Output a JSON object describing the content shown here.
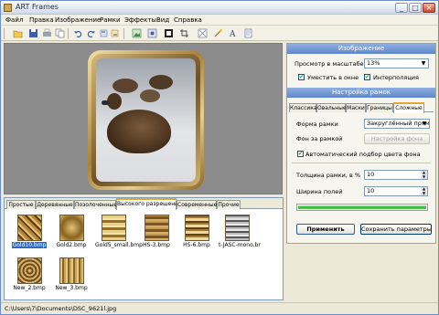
{
  "window": {
    "title": "ART Frames"
  },
  "menu": [
    "Файл",
    "Правка",
    "Изображение",
    "Рамки",
    "Эффекты",
    "Вид",
    "Справка"
  ],
  "toolbar_icons": [
    "open-folder-icon",
    "save-icon",
    "print-icon",
    "copy-icon",
    "undo-icon",
    "redo-icon",
    "rotate-left-icon",
    "rotate-right-icon",
    "image-icon",
    "image-settings-icon",
    "frame-icon",
    "crop-icon",
    "fit-icon",
    "wand-icon",
    "text-icon",
    "properties-icon"
  ],
  "image_panel": {
    "header": "Изображение",
    "preview_label": "Просмотр в масштабе",
    "preview_value": "13%",
    "fit_label": "Уместить в окне",
    "fit_checked": true,
    "interp_label": "Интерполяция",
    "interp_checked": true
  },
  "frame_panel": {
    "header": "Настройка рамок",
    "tabs": [
      "Классика",
      "Овальные",
      "Маски",
      "Границы",
      "Сложные"
    ],
    "active_tab": "Сложные",
    "shape_label": "Форма рамки",
    "shape_value": "Закруглённый прям-к",
    "bg_label": "Фон за рамкой",
    "bg_button": "Настройка фона",
    "auto_color_label": "Автоматический подбор цвета фона",
    "auto_color_checked": true,
    "thickness_label": "Толщина рамки, в %",
    "thickness_value": "10",
    "margin_label": "Ширина полей",
    "margin_value": "10",
    "progress": 1.0,
    "apply_button": "Применить",
    "save_button": "Сохранить параметры"
  },
  "thumb_panel": {
    "tabs": [
      "Простые",
      "Деревянные",
      "Позолоченные",
      "Высокого разрешения",
      "Современные",
      "Прочие"
    ],
    "active_tab": "Высокого разрешения",
    "items": [
      {
        "name": "Gold10.bmp",
        "selected": true
      },
      {
        "name": "Gold2.bmp",
        "selected": false
      },
      {
        "name": "Gold5_small.bmp",
        "selected": false
      },
      {
        "name": "HS-3.bmp",
        "selected": false
      },
      {
        "name": "HS-6.bmp",
        "selected": false
      },
      {
        "name": "t-JASC-mono.br",
        "selected": false
      },
      {
        "name": "New_2.bmp",
        "selected": false
      },
      {
        "name": "New_3.bmp",
        "selected": false
      }
    ]
  },
  "status": {
    "path": "C:\\Users\\7\\Documents\\DSC_9621l.jpg"
  },
  "colors": {
    "accent": "#5f86c9",
    "progress": "#25b324",
    "canvas": "#8c8c8c"
  }
}
